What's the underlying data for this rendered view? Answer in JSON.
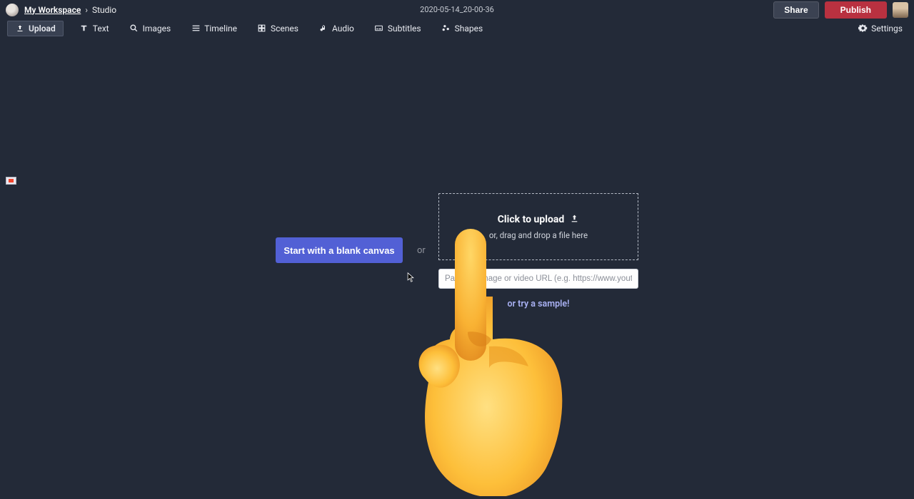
{
  "breadcrumb": {
    "workspace": "My Workspace",
    "separator": "›",
    "current": "Studio"
  },
  "document_title": "2020-05-14_20-00-36",
  "buttons": {
    "share": "Share",
    "publish": "Publish"
  },
  "toolbar": {
    "upload": "Upload",
    "text": "Text",
    "images": "Images",
    "timeline": "Timeline",
    "scenes": "Scenes",
    "audio": "Audio",
    "subtitles": "Subtitles",
    "shapes": "Shapes",
    "settings": "Settings"
  },
  "main": {
    "blank_canvas": "Start with a blank canvas",
    "or": "or",
    "upload_main": "Click to upload",
    "upload_sub": "or, drag and drop a file here",
    "url_placeholder": "Paste an image or video URL (e.g. https://www.youtube.com/",
    "sample": "or try a sample!"
  }
}
